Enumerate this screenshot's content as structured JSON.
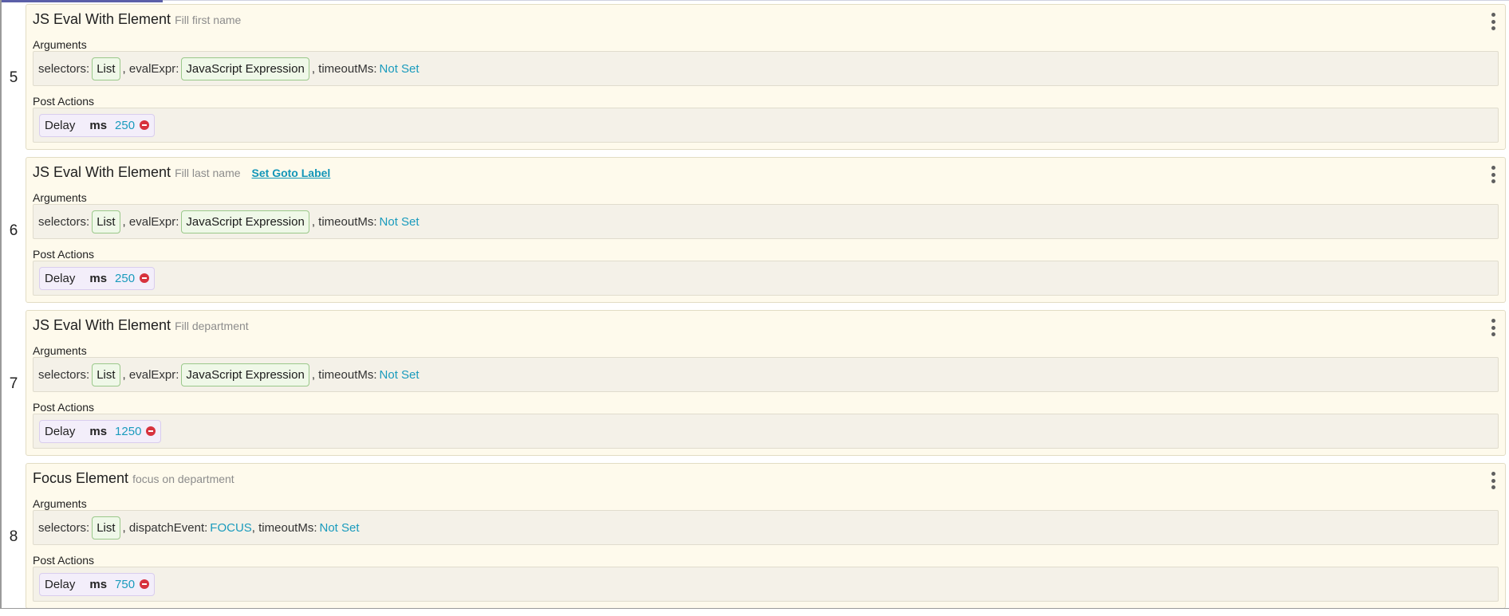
{
  "sections": {
    "arguments": "Arguments",
    "post_actions": "Post Actions"
  },
  "steps": [
    {
      "number": "5",
      "title": "JS Eval With Element",
      "description": "Fill first name",
      "goto_label": "",
      "args": {
        "selectors_label": "selectors:",
        "selectors_value": "List",
        "evalexpr_label": "evalExpr:",
        "evalexpr_value": "JavaScript Expression",
        "timeout_label": "timeoutMs:",
        "timeout_value": "Not Set"
      },
      "post_action": {
        "name": "Delay",
        "unit": "ms",
        "value": "250"
      }
    },
    {
      "number": "6",
      "title": "JS Eval With Element",
      "description": "Fill last name",
      "goto_label": "Set Goto Label",
      "args": {
        "selectors_label": "selectors:",
        "selectors_value": "List",
        "evalexpr_label": "evalExpr:",
        "evalexpr_value": "JavaScript Expression",
        "timeout_label": "timeoutMs:",
        "timeout_value": "Not Set"
      },
      "post_action": {
        "name": "Delay",
        "unit": "ms",
        "value": "250"
      }
    },
    {
      "number": "7",
      "title": "JS Eval With Element",
      "description": "Fill department",
      "goto_label": "",
      "args": {
        "selectors_label": "selectors:",
        "selectors_value": "List",
        "evalexpr_label": "evalExpr:",
        "evalexpr_value": "JavaScript Expression",
        "timeout_label": "timeoutMs:",
        "timeout_value": "Not Set"
      },
      "post_action": {
        "name": "Delay",
        "unit": "ms",
        "value": "1250"
      }
    },
    {
      "number": "8",
      "title": "Focus Element",
      "description": "focus on department",
      "goto_label": "",
      "args": {
        "selectors_label": "selectors:",
        "selectors_value": "List",
        "dispatch_label": "dispatchEvent:",
        "dispatch_value": "FOCUS",
        "timeout_label": "timeoutMs:",
        "timeout_value": "Not Set"
      },
      "post_action": {
        "name": "Delay",
        "unit": "ms",
        "value": "750"
      }
    }
  ]
}
